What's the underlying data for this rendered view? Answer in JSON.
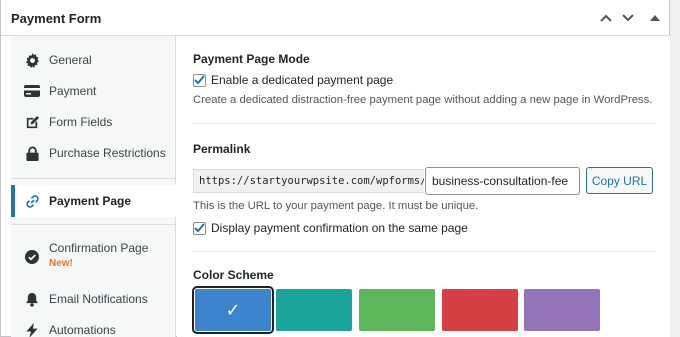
{
  "panel": {
    "title": "Payment Form"
  },
  "sidebar": {
    "items": [
      {
        "label": "General",
        "icon": "gear-icon"
      },
      {
        "label": "Payment",
        "icon": "credit-card-icon"
      },
      {
        "label": "Form Fields",
        "icon": "edit-icon"
      },
      {
        "label": "Purchase Restrictions",
        "icon": "lock-icon"
      },
      {
        "label": "Payment Page",
        "icon": "link-icon",
        "active": true
      },
      {
        "label": "Confirmation Page",
        "icon": "check-circle-icon",
        "badge": "New!"
      },
      {
        "label": "Email Notifications",
        "icon": "bell-icon"
      },
      {
        "label": "Automations",
        "icon": "bolt-icon"
      }
    ]
  },
  "main": {
    "mode_section": {
      "title": "Payment Page Mode",
      "checkbox_label": "Enable a dedicated payment page",
      "checked": true,
      "description": "Create a dedicated distraction-free payment page without adding a new page in WordPress."
    },
    "permalink_section": {
      "title": "Permalink",
      "url_prefix": "https://startyourwpsite.com/wpforms/",
      "slug_value": "business-consultation-fee",
      "copy_button": "Copy URL",
      "description": "This is the URL to your payment page. It must be unique.",
      "confirm_checkbox_label": "Display payment confirmation on the same page",
      "confirm_checked": true
    },
    "color_section": {
      "title": "Color Scheme",
      "swatches": [
        {
          "color": "#3c84cc",
          "selected": true,
          "check": "✓"
        },
        {
          "color": "#19a49c"
        },
        {
          "color": "#5cb65a"
        },
        {
          "color": "#d63f44"
        },
        {
          "color": "#9474b8"
        }
      ]
    }
  },
  "colors": {
    "accent": "#2271b1",
    "badge": "#e27730"
  }
}
